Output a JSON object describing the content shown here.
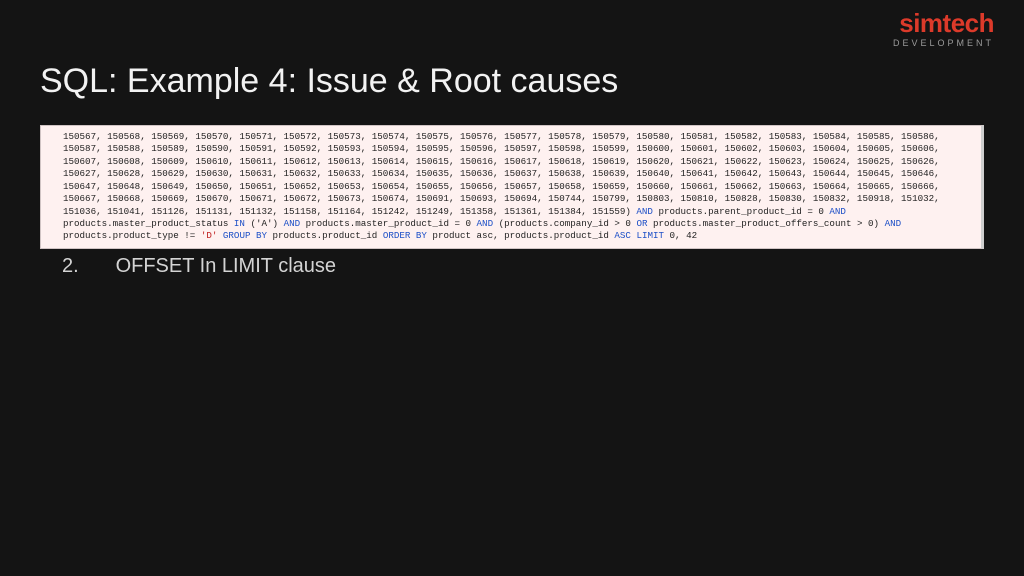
{
  "logo": {
    "main": "simtech",
    "sub": "DEVELOPMENT"
  },
  "title": "SQL: Example 4: Issue & Root causes",
  "code": {
    "ids_line1": "150567, 150568, 150569, 150570, 150571, 150572, 150573, 150574, 150575, 150576, 150577, 150578, 150579, 150580, 150581, 150582, 150583, 150584, 150585, 150586, 150587, 150588,",
    "ids_line2": "150589, 150590, 150591, 150592, 150593, 150594, 150595, 150596, 150597, 150598, 150599, 150600, 150601, 150602, 150603, 150604, 150605, 150606, 150607, 150608, 150609, 150610,",
    "ids_line3": "150611, 150612, 150613, 150614, 150615, 150616, 150617, 150618, 150619, 150620, 150621, 150622, 150623, 150624, 150625, 150626, 150627, 150628, 150629, 150630, 150631, 150632,",
    "ids_line4": "150633, 150634, 150635, 150636, 150637, 150638, 150639, 150640, 150641, 150642, 150643, 150644, 150645, 150646, 150647, 150648, 150649, 150650, 150651, 150652, 150653, 150654,",
    "ids_line5": "150655, 150656, 150657, 150658, 150659, 150660, 150661, 150662, 150663, 150664, 150665, 150666, 150667, 150668, 150669, 150670, 150671, 150672, 150673, 150674, 150691, 150693,",
    "ids_line6": "150694, 150744, 150799, 150803, 150810, 150828, 150830, 150832, 150918, 151032, 151036, 151041, 151126, 151131, 151132, 151158, 151164, 151242, 151249, 151358, 151361, 151384,",
    "tail_close": "151559) ",
    "kw_and": "AND",
    "kw_in": "IN",
    "kw_or": "OR",
    "kw_grp": "GROUP BY",
    "kw_ord": "ORDER BY",
    "kw_asc": "ASC",
    "kw_lim": "LIMIT",
    "c1": " products.parent_product_id = 0 ",
    "c2": " products.master_product_status ",
    "c3": " ('A') ",
    "c4": " products.master_product_id = 0 ",
    "c5": " (products.company_id > 0 ",
    "c6": " products.master_product_offers_count > 0) ",
    "c7": " products.product_type != ",
    "lit_d": "'D'",
    "grp_cols": " products.product_id ",
    "ord_cols": " product asc, products.product_id ",
    "lim_args": " 0, 42"
  },
  "bullet": {
    "num": "2.",
    "text": "OFFSET In LIMIT clause"
  }
}
